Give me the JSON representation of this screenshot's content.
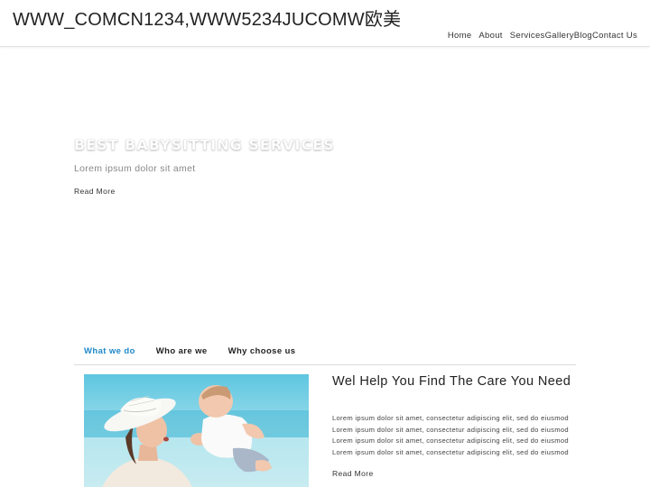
{
  "header": {
    "site_title": "WWW_COMCN1234,WWW5234JUCOMW欧美",
    "nav": [
      "Home",
      "About",
      "Services",
      "Gallery",
      "Blog",
      "Contact Us"
    ]
  },
  "hero": {
    "title": "BEST BABYSITTING SERVICES",
    "subtitle": "Lorem ipsum dolor sit amet",
    "button": "Read More"
  },
  "tabs": [
    {
      "label": "What we do",
      "active": true
    },
    {
      "label": "Who are we",
      "active": false
    },
    {
      "label": "Why choose us",
      "active": false
    }
  ],
  "content": {
    "image_icon": "mother-baby-photo",
    "title": "Wel Help You Find The Care You Need",
    "lines": [
      "Lorem ipsum dolor sit amet, consectetur adipiscing elit, sed do eiusmod",
      "Lorem ipsum dolor sit amet, consectetur adipiscing elit, sed do eiusmod",
      "Lorem ipsum dolor sit amet, consectetur adipiscing elit, sed do eiusmod",
      "Lorem ipsum dolor sit amet, consectetur adipiscing elit, sed do eiusmod"
    ],
    "button": "Read More"
  },
  "colors": {
    "accent": "#1e88c9",
    "text": "#222222",
    "muted": "#888888",
    "divider": "#dcdcdc"
  }
}
